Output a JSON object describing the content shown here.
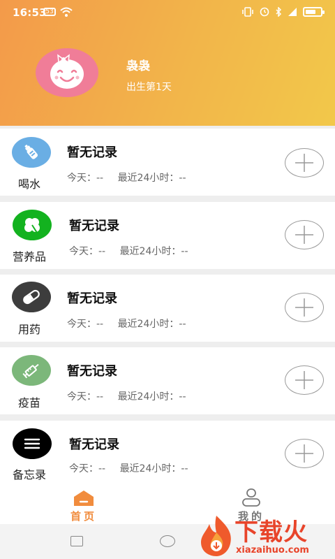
{
  "status": {
    "time": "16:53",
    "left_badge": "53"
  },
  "profile": {
    "name": "袅袅",
    "subtitle": "出生第1天"
  },
  "records": [
    {
      "category": "喝水",
      "title": "暂无记录",
      "today_label": "今天：",
      "today_value": "--",
      "recent_label": "最近24小时：",
      "recent_value": "--",
      "icon": "water-bottle-icon",
      "icon_color": "#6aaee4"
    },
    {
      "category": "营养品",
      "title": "暂无记录",
      "today_label": "今天：",
      "today_value": "--",
      "recent_label": "最近24小时：",
      "recent_value": "--",
      "icon": "clover-icon",
      "icon_color": "#13b21f"
    },
    {
      "category": "用药",
      "title": "暂无记录",
      "today_label": "今天：",
      "today_value": "--",
      "recent_label": "最近24小时：",
      "recent_value": "--",
      "icon": "pill-icon",
      "icon_color": "#3d3d3d"
    },
    {
      "category": "疫苗",
      "title": "暂无记录",
      "today_label": "今天：",
      "today_value": "--",
      "recent_label": "最近24小时：",
      "recent_value": "--",
      "icon": "syringe-icon",
      "icon_color": "#7cb77a"
    },
    {
      "category": "备忘录",
      "title": "暂无记录",
      "today_label": "今天：",
      "today_value": "--",
      "recent_label": "最近24小时：",
      "recent_value": "--",
      "icon": "menu-lines-icon",
      "icon_color": "#000000"
    }
  ],
  "tabs": {
    "home": "首页",
    "mine": "我的"
  },
  "watermark": {
    "main": "下载火",
    "url": "xiazaihuo.com"
  },
  "colors": {
    "accent": "#f18c3d",
    "header_start": "#f39a4a",
    "header_end": "#f2c84a",
    "avatar": "#f07d98"
  }
}
